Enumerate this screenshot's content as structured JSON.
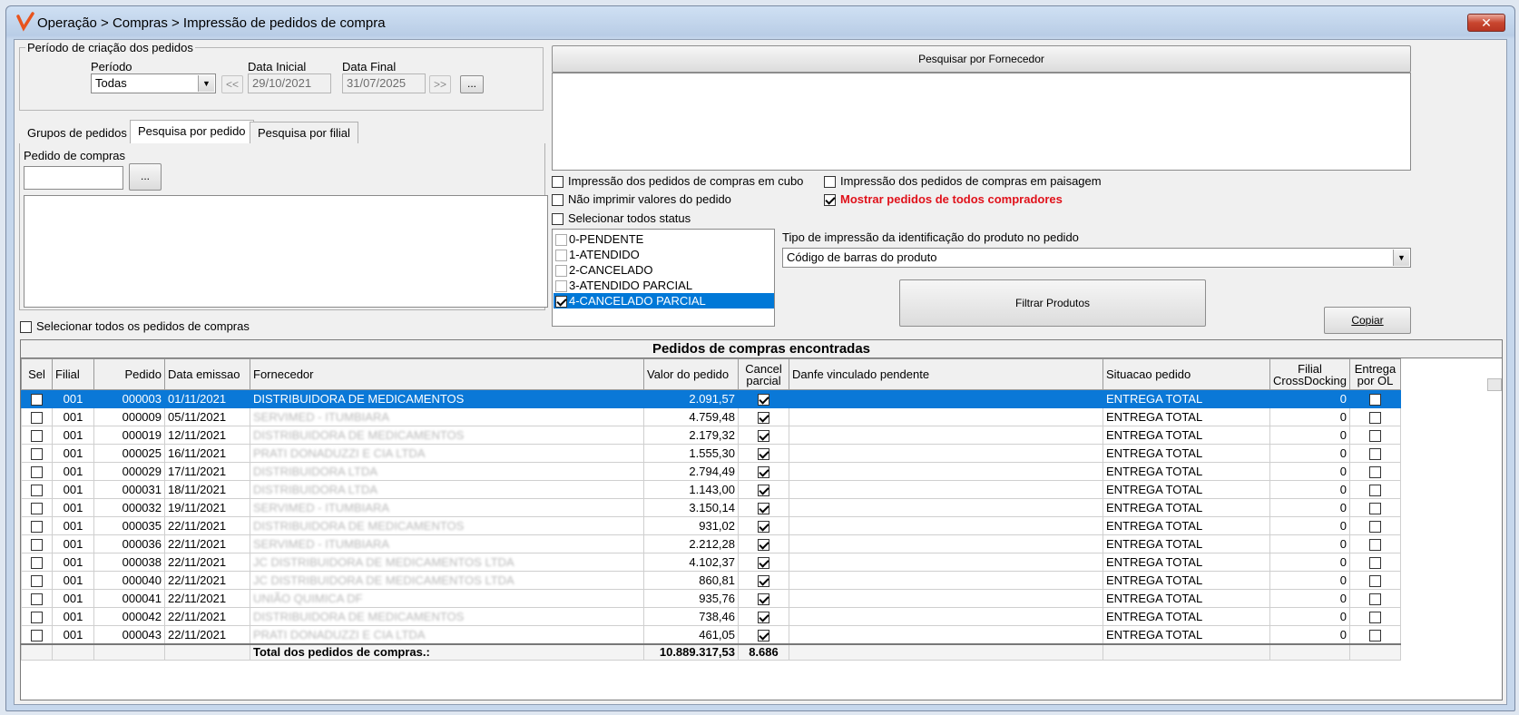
{
  "window": {
    "title": "Operação > Compras > Impressão de pedidos de compra",
    "close_label": "✕"
  },
  "periodo": {
    "group_label": "Período de criação dos pedidos",
    "periodo_label": "Período",
    "periodo_value": "Todas",
    "data_inicial_label": "Data Inicial",
    "data_inicial_value": "29/10/2021",
    "data_final_label": "Data Final",
    "data_final_value": "31/07/2025",
    "prev_label": "<<",
    "next_label": ">>",
    "more_label": "..."
  },
  "tabs": [
    "Grupos de pedidos",
    "Pesquisa por pedido",
    "Pesquisa por filial"
  ],
  "pedido": {
    "label": "Pedido de compras",
    "value": "",
    "browse_label": "..."
  },
  "select_all_pedidos": "Selecionar todos os pedidos de compras",
  "fornecedor_header": "Pesquisar por Fornecedor",
  "options": {
    "cubo": "Impressão dos pedidos de compras em cubo",
    "paisagem": "Impressão dos pedidos de compras em paisagem",
    "nao_imprimir": "Não imprimir valores do pedido",
    "mostrar_todos": "Mostrar pedidos de todos compradores",
    "selecionar_status": "Selecionar todos status"
  },
  "status_list": [
    {
      "label": "0-PENDENTE",
      "checked": false
    },
    {
      "label": "1-ATENDIDO",
      "checked": false
    },
    {
      "label": "2-CANCELADO",
      "checked": false
    },
    {
      "label": "3-ATENDIDO PARCIAL",
      "checked": false
    },
    {
      "label": "4-CANCELADO PARCIAL",
      "checked": true
    }
  ],
  "tipo_impressao": {
    "label": "Tipo de impressão da identificação do produto no pedido",
    "value": "Código de barras do produto"
  },
  "filtrar_label": "Filtrar Produtos",
  "copiar_label": "Copiar",
  "grid": {
    "title": "Pedidos de compras encontradas",
    "columns": [
      "Sel",
      "Filial",
      "Pedido",
      "Data emissao",
      "Fornecedor",
      "Valor do pedido",
      "Cancel parcial",
      "Danfe vinculado pendente",
      "Situacao pedido",
      "Filial CrossDocking",
      "Entrega por OL"
    ],
    "rows": [
      {
        "filial": "001",
        "pedido": "000003",
        "data": "01/11/2021",
        "fornecedor": "DISTRIBUIDORA DE MEDICAMENTOS",
        "valor": "2.091,57",
        "situacao": "ENTREGA TOTAL",
        "cross": "0"
      },
      {
        "filial": "001",
        "pedido": "000009",
        "data": "05/11/2021",
        "fornecedor": "SERVIMED - ITUMBIARA",
        "valor": "4.759,48",
        "situacao": "ENTREGA TOTAL",
        "cross": "0"
      },
      {
        "filial": "001",
        "pedido": "000019",
        "data": "12/11/2021",
        "fornecedor": "DISTRIBUIDORA DE MEDICAMENTOS",
        "valor": "2.179,32",
        "situacao": "ENTREGA TOTAL",
        "cross": "0"
      },
      {
        "filial": "001",
        "pedido": "000025",
        "data": "16/11/2021",
        "fornecedor": "PRATI DONADUZZI E CIA LTDA",
        "valor": "1.555,30",
        "situacao": "ENTREGA TOTAL",
        "cross": "0"
      },
      {
        "filial": "001",
        "pedido": "000029",
        "data": "17/11/2021",
        "fornecedor": "DISTRIBUIDORA LTDA",
        "valor": "2.794,49",
        "situacao": "ENTREGA TOTAL",
        "cross": "0"
      },
      {
        "filial": "001",
        "pedido": "000031",
        "data": "18/11/2021",
        "fornecedor": "DISTRIBUIDORA LTDA",
        "valor": "1.143,00",
        "situacao": "ENTREGA TOTAL",
        "cross": "0"
      },
      {
        "filial": "001",
        "pedido": "000032",
        "data": "19/11/2021",
        "fornecedor": "SERVIMED - ITUMBIARA",
        "valor": "3.150,14",
        "situacao": "ENTREGA TOTAL",
        "cross": "0"
      },
      {
        "filial": "001",
        "pedido": "000035",
        "data": "22/11/2021",
        "fornecedor": "DISTRIBUIDORA DE MEDICAMENTOS",
        "valor": "931,02",
        "situacao": "ENTREGA TOTAL",
        "cross": "0"
      },
      {
        "filial": "001",
        "pedido": "000036",
        "data": "22/11/2021",
        "fornecedor": "SERVIMED - ITUMBIARA",
        "valor": "2.212,28",
        "situacao": "ENTREGA TOTAL",
        "cross": "0"
      },
      {
        "filial": "001",
        "pedido": "000038",
        "data": "22/11/2021",
        "fornecedor": "JC DISTRIBUIDORA DE MEDICAMENTOS LTDA",
        "valor": "4.102,37",
        "situacao": "ENTREGA TOTAL",
        "cross": "0"
      },
      {
        "filial": "001",
        "pedido": "000040",
        "data": "22/11/2021",
        "fornecedor": "JC DISTRIBUIDORA DE MEDICAMENTOS LTDA",
        "valor": "860,81",
        "situacao": "ENTREGA TOTAL",
        "cross": "0"
      },
      {
        "filial": "001",
        "pedido": "000041",
        "data": "22/11/2021",
        "fornecedor": "UNIÃO QUIMICA DF",
        "valor": "935,76",
        "situacao": "ENTREGA TOTAL",
        "cross": "0"
      },
      {
        "filial": "001",
        "pedido": "000042",
        "data": "22/11/2021",
        "fornecedor": "DISTRIBUIDORA DE MEDICAMENTOS",
        "valor": "738,46",
        "situacao": "ENTREGA TOTAL",
        "cross": "0"
      },
      {
        "filial": "001",
        "pedido": "000043",
        "data": "22/11/2021",
        "fornecedor": "PRATI DONADUZZI E CIA LTDA",
        "valor": "461,05",
        "situacao": "ENTREGA TOTAL",
        "cross": "0"
      }
    ],
    "footer": {
      "label": "Total dos pedidos de compras.:",
      "total_valor": "10.889.317,53",
      "total_cancel": "8.686"
    }
  },
  "colors": {
    "selection": "#0078d7",
    "accent_red": "#e0111a"
  }
}
